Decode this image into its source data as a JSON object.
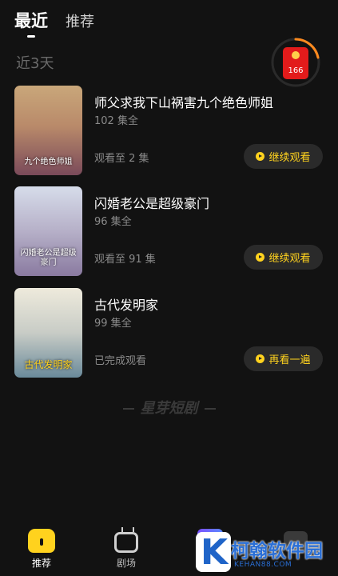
{
  "header": {
    "tab_active": "最近",
    "tab_other": "推荐"
  },
  "section_title": "近3天",
  "redpacket": {
    "count": "166"
  },
  "items": [
    {
      "title": "师父求我下山祸害九个绝色师姐",
      "episodes": "102 集全",
      "progress": "观看至 2 集",
      "button": "继续观看",
      "poster_text": "九个绝色师姐",
      "poster_color_top": "#c9a77a",
      "poster_color_bottom": "#7a4a5a"
    },
    {
      "title": "闪婚老公是超级豪门",
      "episodes": "96 集全",
      "progress": "观看至 91 集",
      "button": "继续观看",
      "poster_text": "闪婚老公是超级豪门",
      "poster_color_top": "#c8d0e0",
      "poster_color_bottom": "#8a7aa0"
    },
    {
      "title": "古代发明家",
      "episodes": "99 集全",
      "progress": "已完成观看",
      "button": "再看一遍",
      "poster_text": "古代发明家",
      "poster_color_top": "#e6e2d6",
      "poster_color_bottom": "#6a8a9a"
    }
  ],
  "brand": "星芽短剧",
  "nav": [
    {
      "label": "推荐",
      "icon": "home-icon"
    },
    {
      "label": "剧场",
      "icon": "tv-icon"
    }
  ],
  "watermark": {
    "logo_letter": "K",
    "text": "柯翰软件园",
    "url": "KEHAN88.COM"
  },
  "colors": {
    "background": "#121212",
    "accent": "#ffd21e",
    "button_bg": "#2a2a2a"
  }
}
